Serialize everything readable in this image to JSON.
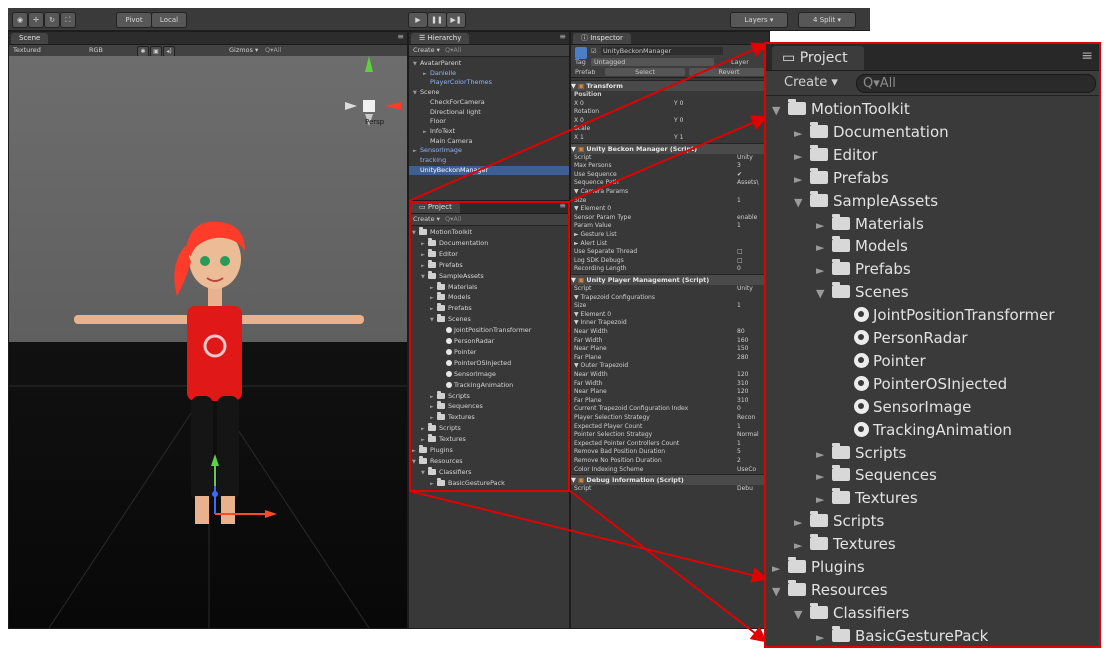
{
  "toolbar": {
    "pivot": "Pivot",
    "local": "Local",
    "layers": "Layers",
    "layout": "4 Split"
  },
  "scene": {
    "tab": "Scene",
    "shading": "Textured",
    "render_mode": "RGB",
    "gizmos": "Gizmos",
    "search": "All",
    "persp": "Persp"
  },
  "hierarchy": {
    "tab": "Hierarchy",
    "create": "Create",
    "search": "All",
    "items": [
      {
        "label": "AvatarParent",
        "depth": 0,
        "arrow": "▼",
        "color": "#d6d6d6",
        "selected": false
      },
      {
        "label": "Danielle",
        "depth": 1,
        "arrow": "►",
        "color": "#8fb4ff",
        "selected": false
      },
      {
        "label": "PlayerColorThemes",
        "depth": 1,
        "arrow": "",
        "color": "#8fb4ff",
        "selected": false
      },
      {
        "label": "Scene",
        "depth": 0,
        "arrow": "▼",
        "color": "#d6d6d6",
        "selected": false
      },
      {
        "label": "CheckForCamera",
        "depth": 1,
        "arrow": "",
        "color": "#d6d6d6",
        "selected": false
      },
      {
        "label": "Directional light",
        "depth": 1,
        "arrow": "",
        "color": "#d6d6d6",
        "selected": false
      },
      {
        "label": "Floor",
        "depth": 1,
        "arrow": "",
        "color": "#d6d6d6",
        "selected": false
      },
      {
        "label": "InfoText",
        "depth": 1,
        "arrow": "►",
        "color": "#d6d6d6",
        "selected": false
      },
      {
        "label": "Main Camera",
        "depth": 1,
        "arrow": "",
        "color": "#d6d6d6",
        "selected": false
      },
      {
        "label": "SensorImage",
        "depth": 0,
        "arrow": "►",
        "color": "#8fb4ff",
        "selected": false
      },
      {
        "label": "tracking",
        "depth": 0,
        "arrow": "",
        "color": "#8fb4ff",
        "selected": false
      },
      {
        "label": "UnityBeckonManager",
        "depth": 0,
        "arrow": "",
        "color": "#ffffff",
        "selected": true
      }
    ]
  },
  "project_small": {
    "tab": "Project",
    "create": "Create",
    "search": "All"
  },
  "project": {
    "tab": "Project",
    "create": "Create",
    "search": "All",
    "items": [
      {
        "label": "MotionToolkit",
        "depth": 0,
        "arrow": "▼",
        "kind": "folder"
      },
      {
        "label": "Documentation",
        "depth": 1,
        "arrow": "►",
        "kind": "folder"
      },
      {
        "label": "Editor",
        "depth": 1,
        "arrow": "►",
        "kind": "folder"
      },
      {
        "label": "Prefabs",
        "depth": 1,
        "arrow": "►",
        "kind": "folder"
      },
      {
        "label": "SampleAssets",
        "depth": 1,
        "arrow": "▼",
        "kind": "folder"
      },
      {
        "label": "Materials",
        "depth": 2,
        "arrow": "►",
        "kind": "folder"
      },
      {
        "label": "Models",
        "depth": 2,
        "arrow": "►",
        "kind": "folder"
      },
      {
        "label": "Prefabs",
        "depth": 2,
        "arrow": "►",
        "kind": "folder"
      },
      {
        "label": "Scenes",
        "depth": 2,
        "arrow": "▼",
        "kind": "folder"
      },
      {
        "label": "JointPositionTransformer",
        "depth": 3,
        "arrow": "",
        "kind": "scene"
      },
      {
        "label": "PersonRadar",
        "depth": 3,
        "arrow": "",
        "kind": "scene"
      },
      {
        "label": "Pointer",
        "depth": 3,
        "arrow": "",
        "kind": "scene"
      },
      {
        "label": "PointerOSInjected",
        "depth": 3,
        "arrow": "",
        "kind": "scene"
      },
      {
        "label": "SensorImage",
        "depth": 3,
        "arrow": "",
        "kind": "scene"
      },
      {
        "label": "TrackingAnimation",
        "depth": 3,
        "arrow": "",
        "kind": "scene"
      },
      {
        "label": "Scripts",
        "depth": 2,
        "arrow": "►",
        "kind": "folder"
      },
      {
        "label": "Sequences",
        "depth": 2,
        "arrow": "►",
        "kind": "folder"
      },
      {
        "label": "Textures",
        "depth": 2,
        "arrow": "►",
        "kind": "folder"
      },
      {
        "label": "Scripts",
        "depth": 1,
        "arrow": "►",
        "kind": "folder"
      },
      {
        "label": "Textures",
        "depth": 1,
        "arrow": "►",
        "kind": "folder"
      },
      {
        "label": "Plugins",
        "depth": 0,
        "arrow": "►",
        "kind": "folder"
      },
      {
        "label": "Resources",
        "depth": 0,
        "arrow": "▼",
        "kind": "folder"
      },
      {
        "label": "Classifiers",
        "depth": 1,
        "arrow": "▼",
        "kind": "folder"
      },
      {
        "label": "BasicGesturePack",
        "depth": 2,
        "arrow": "►",
        "kind": "folder"
      }
    ]
  },
  "inspector": {
    "tab": "Inspector",
    "object_name": "UnityBeckonManager",
    "tag_label": "Tag",
    "tag_value": "Untagged",
    "layer_label": "Layer",
    "prefab_label": "Prefab",
    "select": "Select",
    "revert": "Revert",
    "rows": [
      {
        "label": "Transform",
        "value": "",
        "type": "component"
      },
      {
        "label": "Position",
        "value": "",
        "type": "bold"
      },
      {
        "label": "X 0",
        "value": "Y 0",
        "type": "vec"
      },
      {
        "label": "Rotation",
        "value": "",
        "type": "plain"
      },
      {
        "label": "X 0",
        "value": "Y 0",
        "type": "vec"
      },
      {
        "label": "Scale",
        "value": "",
        "type": "plain"
      },
      {
        "label": "X 1",
        "value": "Y 1",
        "type": "vec"
      },
      {
        "label": "Unity Beckon Manager (Script)",
        "value": "",
        "type": "component"
      },
      {
        "label": "Script",
        "value": "Unity",
        "type": "plain"
      },
      {
        "label": "Max Persons",
        "value": "3",
        "type": "plain"
      },
      {
        "label": "Use Sequence",
        "value": "✔",
        "type": "plain"
      },
      {
        "label": "Sequence Path",
        "value": "Assets\\",
        "type": "plain"
      },
      {
        "label": "▼ Camera Params",
        "value": "",
        "type": "plain"
      },
      {
        "label": "   Size",
        "value": "1",
        "type": "plain"
      },
      {
        "label": "   ▼ Element 0",
        "value": "",
        "type": "plain"
      },
      {
        "label": "      Sensor Param Type",
        "value": "enable",
        "type": "plain"
      },
      {
        "label": "      Param Value",
        "value": "1",
        "type": "plain"
      },
      {
        "label": "► Gesture List",
        "value": "",
        "type": "plain"
      },
      {
        "label": "► Alert List",
        "value": "",
        "type": "plain"
      },
      {
        "label": "Use Separate Thread",
        "value": "□",
        "type": "plain"
      },
      {
        "label": "Log SDK Debugs",
        "value": "□",
        "type": "plain"
      },
      {
        "label": "Recording Length",
        "value": "0",
        "type": "plain"
      },
      {
        "label": "Unity Player Management (Script)",
        "value": "",
        "type": "component"
      },
      {
        "label": "Script",
        "value": "Unity",
        "type": "plain"
      },
      {
        "label": "▼ Trapezoid Configurations",
        "value": "",
        "type": "plain"
      },
      {
        "label": "   Size",
        "value": "1",
        "type": "plain"
      },
      {
        "label": "   ▼ Element 0",
        "value": "",
        "type": "plain"
      },
      {
        "label": "      ▼ Inner Trapezoid",
        "value": "",
        "type": "plain"
      },
      {
        "label": "            Near Width",
        "value": "80",
        "type": "plain"
      },
      {
        "label": "            Far Width",
        "value": "160",
        "type": "plain"
      },
      {
        "label": "            Near Plane",
        "value": "150",
        "type": "plain"
      },
      {
        "label": "            Far Plane",
        "value": "280",
        "type": "plain"
      },
      {
        "label": "      ▼ Outer Trapezoid",
        "value": "",
        "type": "plain"
      },
      {
        "label": "            Near Width",
        "value": "120",
        "type": "plain"
      },
      {
        "label": "            Far Width",
        "value": "310",
        "type": "plain"
      },
      {
        "label": "            Near Plane",
        "value": "120",
        "type": "plain"
      },
      {
        "label": "            Far Plane",
        "value": "310",
        "type": "plain"
      },
      {
        "label": "Current Trapezoid Configuration Index",
        "value": "0",
        "type": "plain"
      },
      {
        "label": "Player Selection Strategy",
        "value": "Recon",
        "type": "plain"
      },
      {
        "label": "Expected Player Count",
        "value": "1",
        "type": "plain"
      },
      {
        "label": "Pointer Selection Strategy",
        "value": "Normal",
        "type": "plain"
      },
      {
        "label": "Expected Pointer Controllers Count",
        "value": "1",
        "type": "plain"
      },
      {
        "label": "Remove Bad Position Duration",
        "value": "5",
        "type": "plain"
      },
      {
        "label": "Remove No Position Duration",
        "value": "2",
        "type": "plain"
      },
      {
        "label": "Color Indexing Scheme",
        "value": "UseCo",
        "type": "plain"
      },
      {
        "label": "Debug Information (Script)",
        "value": "",
        "type": "component"
      },
      {
        "label": "Script",
        "value": "Debu",
        "type": "plain"
      }
    ]
  },
  "colors": {
    "highlight": "#e00000",
    "selection": "#3d5f93",
    "prefab_text": "#8fb4ff"
  }
}
